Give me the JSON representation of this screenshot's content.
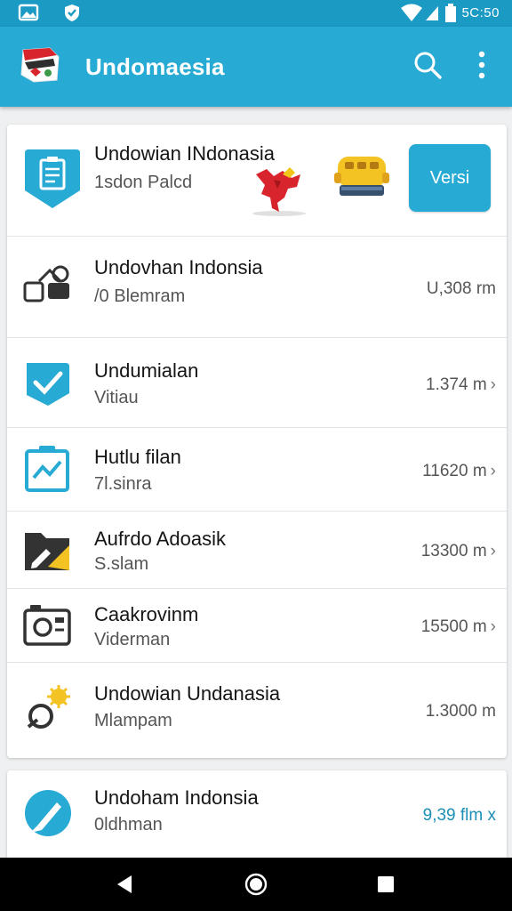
{
  "status_bar": {
    "time": "5C:50",
    "icons": [
      "gallery-notification-icon",
      "shield-notification-icon",
      "wifi-icon",
      "signal-icon",
      "battery-icon"
    ]
  },
  "app_bar": {
    "title": "Undomaesia",
    "icons": [
      "indonesia-flag-logo",
      "search-icon",
      "more-vert-icon"
    ]
  },
  "featured": {
    "title": "Undowian INdonasia",
    "subtitle": "1sdon Palcd",
    "button_label": "Versi"
  },
  "list": [
    {
      "title": "Undovhan Indonsia",
      "subtitle": "/0 Blemram",
      "value": "U,308 rm",
      "chevron": false,
      "icon": "shapes-icon"
    },
    {
      "title": "Undumialan",
      "subtitle": "Vitiau",
      "value": "1.374 m",
      "chevron": true,
      "icon": "check-badge-icon"
    },
    {
      "title": "Hutlu filan",
      "subtitle": "7l.sinra",
      "value": "11620 m",
      "chevron": true,
      "icon": "chart-clipboard-icon"
    },
    {
      "title": "Aufrdo Adoasik",
      "subtitle": "S.slam",
      "value": "13300 m",
      "chevron": true,
      "icon": "edit-folder-icon"
    },
    {
      "title": "Caakrovinm",
      "subtitle": "Viderman",
      "value": "15500 m",
      "chevron": true,
      "icon": "camera-icon"
    },
    {
      "title": "Undowian Undanasia",
      "subtitle": "Mlampam",
      "value": "1.3000 m",
      "chevron": false,
      "icon": "settings-link-icon"
    }
  ],
  "bottom_item": {
    "title": "Undoham Indonsia",
    "subtitle": "0ldhman",
    "value": "9,39 flm x",
    "icon": "pen-circle-icon"
  },
  "nav_bar": {
    "icons": [
      "back-icon",
      "home-icon",
      "recents-icon"
    ]
  },
  "colors": {
    "primary": "#27aad3",
    "status": "#1b9ac4",
    "accent_teal": "#1b8fb6"
  }
}
